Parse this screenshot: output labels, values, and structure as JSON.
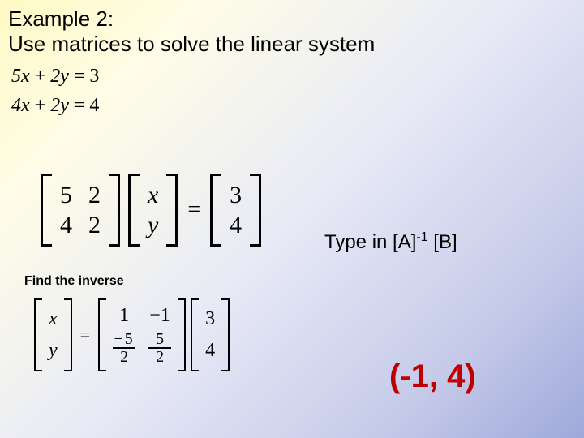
{
  "header": {
    "title_line1": "Example 2:",
    "title_line2": "Use matrices to solve the linear system"
  },
  "equations": {
    "eq1": "5x + 2y = 3",
    "eq2": "4x + 2y = 4"
  },
  "matrix_form": {
    "A": [
      [
        "5",
        "2"
      ],
      [
        "4",
        "2"
      ]
    ],
    "X": [
      "x",
      "y"
    ],
    "eq": "=",
    "B": [
      "3",
      "4"
    ]
  },
  "hint": {
    "prefix": "Type in [A]",
    "sup": "-1",
    "suffix": " [B]"
  },
  "find_inverse_label": "Find the inverse",
  "inverse_form": {
    "X": [
      "x",
      "y"
    ],
    "eq": "=",
    "Ainv": {
      "r1": [
        "1",
        "−1"
      ],
      "r2_c1": {
        "neg": "−",
        "num": "5",
        "den": "2"
      },
      "r2_c2": {
        "num": "5",
        "den": "2"
      }
    },
    "B": [
      "3",
      "4"
    ]
  },
  "answer": "(-1, 4)"
}
